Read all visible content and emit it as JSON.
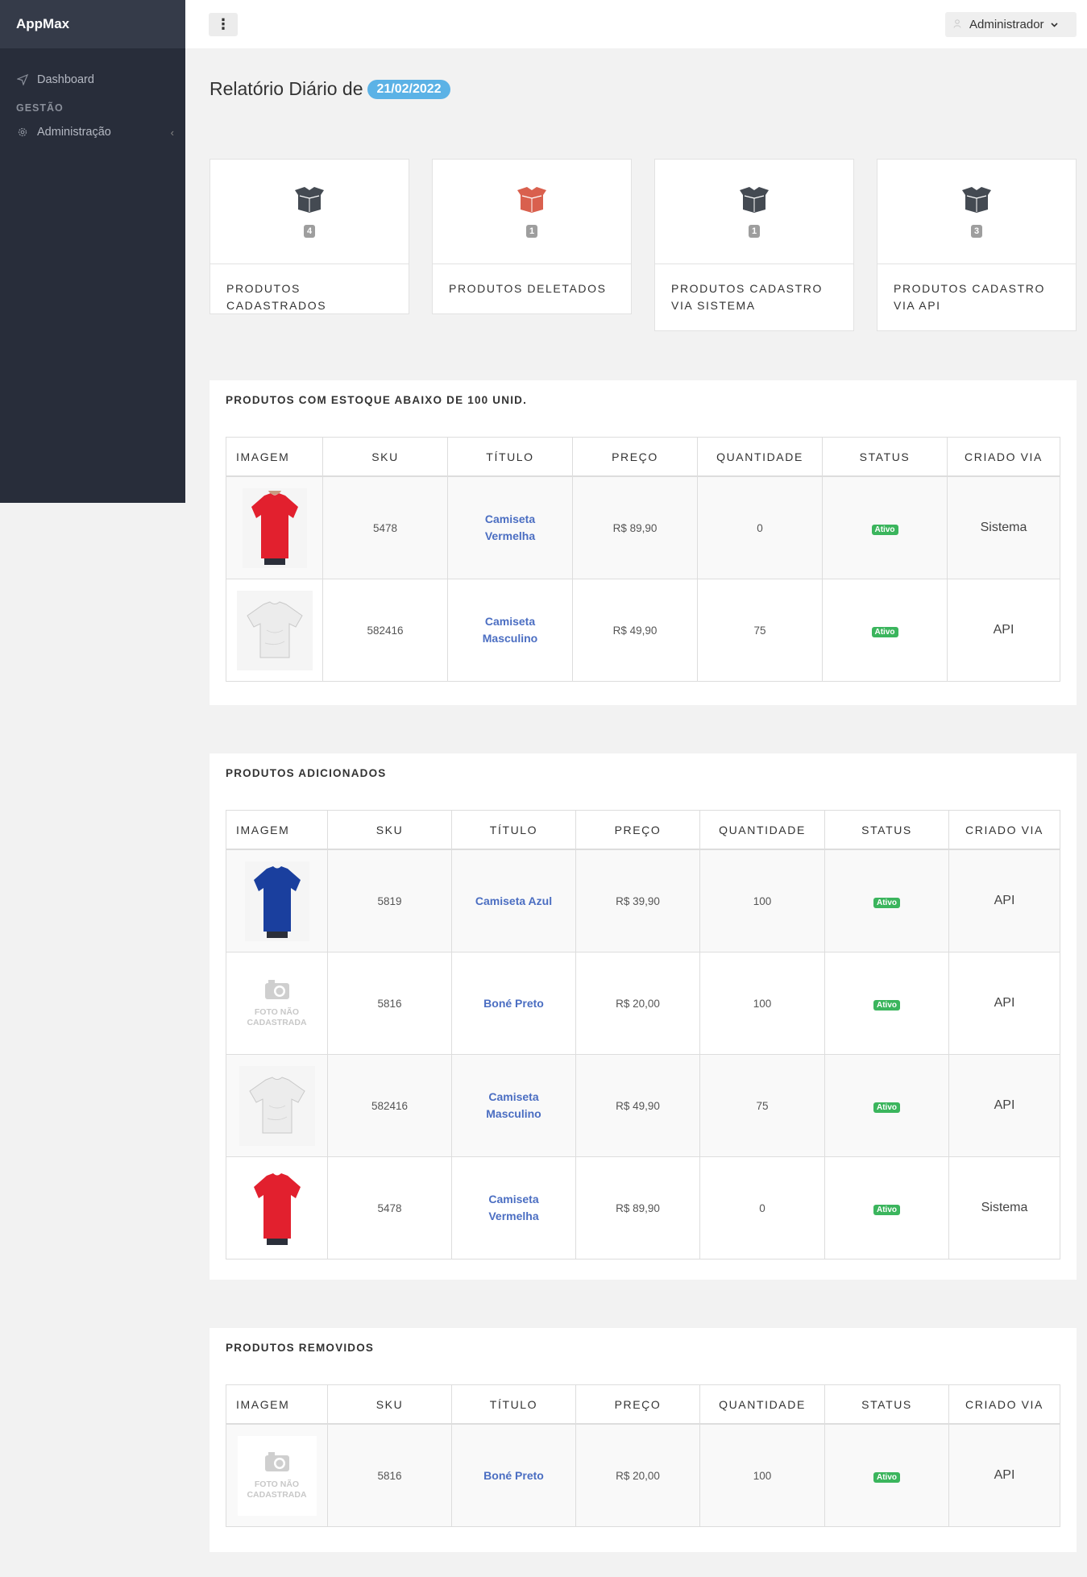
{
  "app": {
    "brand": "AppMax"
  },
  "sidebar": {
    "items": [
      {
        "label": "Dashboard",
        "icon": "send-icon"
      }
    ],
    "heading": "GESTÃO",
    "admin": {
      "label": "Administração",
      "icon": "gear-icon"
    }
  },
  "topbar": {
    "user_label": "Administrador"
  },
  "page": {
    "title": "Relatório Diário de",
    "date": "21/02/2022"
  },
  "stats": [
    {
      "count": "4",
      "label": "PRODUTOS CADASTRADOS",
      "color": "#444a52"
    },
    {
      "count": "1",
      "label": "PRODUTOS DELETADOS",
      "color": "#d9604e"
    },
    {
      "count": "1",
      "label": "PRODUTOS CADASTRO VIA SISTEMA",
      "color": "#444a52"
    },
    {
      "count": "3",
      "label": "PRODUTOS CADASTRO VIA API",
      "color": "#444a52"
    }
  ],
  "columns": [
    "IMAGEM",
    "SKU",
    "TÍTULO",
    "PREÇO",
    "QUANTIDADE",
    "STATUS",
    "CRIADO VIA"
  ],
  "no_photo_text": [
    "FOTO NÃO",
    "CADASTRADA"
  ],
  "tables": [
    {
      "title": "PRODUTOS COM ESTOQUE ABAIXO DE 100 UNID.",
      "rows": [
        {
          "image": "red-shirt",
          "sku": "5478",
          "title": [
            "Camiseta",
            "Vermelha"
          ],
          "price": "R$ 89,90",
          "qty": "0",
          "status": "Ativo",
          "via": "Sistema"
        },
        {
          "image": "white-shirt",
          "sku": "582416",
          "title": [
            "Camiseta",
            "Masculino"
          ],
          "price": "R$ 49,90",
          "qty": "75",
          "status": "Ativo",
          "via": "API"
        }
      ]
    },
    {
      "title": "PRODUTOS ADICIONADOS",
      "rows": [
        {
          "image": "blue-shirt",
          "sku": "5819",
          "title": [
            "Camiseta Azul"
          ],
          "price": "R$ 39,90",
          "qty": "100",
          "status": "Ativo",
          "via": "API"
        },
        {
          "image": "no-photo",
          "sku": "5816",
          "title": [
            "Boné Preto"
          ],
          "price": "R$ 20,00",
          "qty": "100",
          "status": "Ativo",
          "via": "API"
        },
        {
          "image": "white-shirt",
          "sku": "582416",
          "title": [
            "Camiseta",
            "Masculino"
          ],
          "price": "R$ 49,90",
          "qty": "75",
          "status": "Ativo",
          "via": "API"
        },
        {
          "image": "red-shirt",
          "sku": "5478",
          "title": [
            "Camiseta",
            "Vermelha"
          ],
          "price": "R$ 89,90",
          "qty": "0",
          "status": "Ativo",
          "via": "Sistema"
        }
      ]
    },
    {
      "title": "PRODUTOS REMOVIDOS",
      "rows": [
        {
          "image": "no-photo",
          "sku": "5816",
          "title": [
            "Boné Preto"
          ],
          "price": "R$ 20,00",
          "qty": "100",
          "status": "Ativo",
          "via": "API"
        }
      ]
    }
  ],
  "colors": {
    "sidebar": "#282d3a",
    "badge": "#5bb2e6",
    "status": "#3bb55d",
    "link": "#4b6ec2"
  }
}
